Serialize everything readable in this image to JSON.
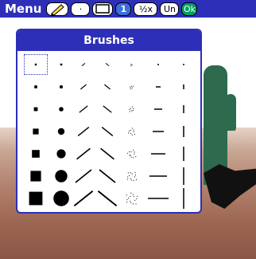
{
  "toolbar": {
    "menu_label": "Menu",
    "buttons": [
      {
        "name": "pencil-tool-button",
        "label": "",
        "icon": "pencil-icon"
      },
      {
        "name": "dot-brush-button",
        "label": "·",
        "icon": "dot-icon"
      },
      {
        "name": "rectangle-tool-button",
        "label": "",
        "icon": "rectangle-icon"
      },
      {
        "name": "zoom-1x-button",
        "label": "1",
        "selected": true
      },
      {
        "name": "zoom-half-button",
        "label": "½x"
      },
      {
        "name": "undo-button",
        "label": "Un"
      },
      {
        "name": "ok-button",
        "label": "Ok"
      }
    ]
  },
  "popup": {
    "title": "Brushes",
    "rows": 7,
    "columns": [
      "square",
      "circle",
      "slash",
      "backslash",
      "spray",
      "horizontal-line",
      "vertical-line"
    ],
    "selected": {
      "row": 0,
      "col": 0
    }
  },
  "colors": {
    "accent": "#2d2fb8",
    "selected": "#3a6fd8",
    "ok": "#00a060",
    "cactus": "#2d6a4e"
  }
}
